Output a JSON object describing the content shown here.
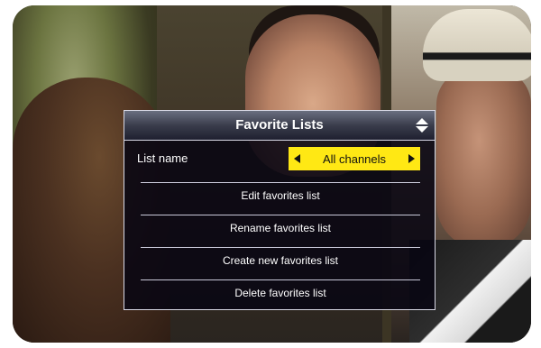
{
  "osd": {
    "title": "Favorite Lists",
    "list_name": {
      "label": "List name",
      "value": "All channels"
    },
    "menu_items": [
      "Edit favorites list",
      "Rename favorites list",
      "Create new favorites list",
      "Delete favorites list"
    ]
  },
  "colors": {
    "selector_bg": "#ffe814",
    "panel_bg": "#080612"
  }
}
